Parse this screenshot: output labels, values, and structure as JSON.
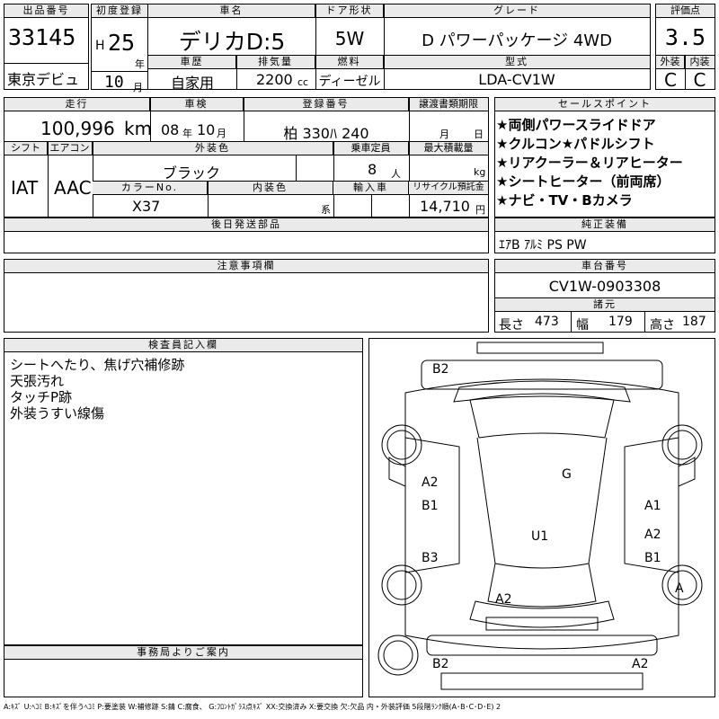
{
  "lot": {
    "header": "出品番号",
    "value": "33145",
    "venue": "東京デビュ"
  },
  "first_reg": {
    "header": "初度登録",
    "era": "H",
    "year": "25",
    "year_unit": "年",
    "month": "10",
    "month_unit": "月"
  },
  "car_name": {
    "header": "車名",
    "value": "デリカD:5"
  },
  "door": {
    "header": "ドア形状",
    "value": "5W"
  },
  "grade": {
    "header": "グレード",
    "value": "D パワーパッケージ 4WD"
  },
  "score": {
    "header": "評価点",
    "value": "3.5"
  },
  "history": {
    "header": "車歴",
    "value": "自家用"
  },
  "displacement": {
    "header": "排気量",
    "value": "2200",
    "unit": "cc"
  },
  "fuel": {
    "header": "燃料",
    "value": "ディーゼル"
  },
  "model": {
    "header": "型式",
    "value": "LDA-CV1W"
  },
  "exterior_score": {
    "header": "外装",
    "value": "C"
  },
  "interior_score": {
    "header": "内装",
    "value": "C"
  },
  "mileage": {
    "header": "走行",
    "value": "100,996",
    "unit": "km"
  },
  "inspection": {
    "header": "車検",
    "year": "08",
    "year_unit": "年",
    "month": "10",
    "month_unit": "月"
  },
  "registration": {
    "header": "登録番号",
    "value": "柏 330ﾊ 240"
  },
  "transfer": {
    "header": "譲渡書類期限",
    "month_unit": "月",
    "day_unit": "日"
  },
  "shift": {
    "header": "シフト",
    "value": "IAT"
  },
  "aircon": {
    "header": "エアコン",
    "value": "AAC"
  },
  "exterior_color": {
    "header": "外装色",
    "value": "ブラック"
  },
  "capacity": {
    "header": "乗車定員",
    "value": "8",
    "unit": "人"
  },
  "max_load": {
    "header": "最大積載量",
    "unit": "kg"
  },
  "color_no": {
    "header": "カラーNo.",
    "value": "X37"
  },
  "interior_color": {
    "header": "内装色",
    "unit": "系"
  },
  "import": {
    "header": "輸入車"
  },
  "recycle": {
    "header": "リサイクル預託金",
    "value": "14,710",
    "unit": "円"
  },
  "later_parts": {
    "header": "後日発送部品"
  },
  "sales_points": {
    "header": "セールスポイント",
    "items": [
      "★両側パワースライドドア",
      "★クルコン★パドルシフト",
      "★リアクーラー＆リアヒーター",
      "★シートヒーター（前両席）",
      "★ナビ・TV・Bカメラ"
    ]
  },
  "equipment": {
    "header": "純正装備",
    "value": "ｴｱB ｱﾙﾐ PS PW"
  },
  "notes": {
    "header": "注意事項欄"
  },
  "chassis": {
    "header": "車台番号",
    "value": "CV1W-0903308"
  },
  "dimensions": {
    "header": "諸元",
    "length_label": "長さ",
    "length": "473",
    "width_label": "幅",
    "width": "179",
    "height_label": "高さ",
    "height": "187"
  },
  "inspector": {
    "header": "検査員記入欄",
    "lines": [
      "シートへたり、焦げ穴補修跡",
      "天張汚れ",
      "タッチP跡",
      "外装うすい線傷"
    ]
  },
  "office": {
    "header": "事務局よりご案内"
  },
  "damage_marks": [
    "B2",
    "G",
    "A2",
    "B1",
    "A1",
    "A2",
    "B1",
    "U1",
    "B3",
    "A2",
    "A",
    "B2",
    "A2"
  ],
  "legend": "A:ｷｽﾞ U:ﾍｺﾐ B:ｷｽﾞを伴うﾍｺﾐ P:要塗装 W:補修跡 S:錆 C:腐食、 G:ﾌﾛﾝﾄｶﾞﾗｽ点ｷｽﾞ XX:交換済み X:要交換 欠:欠品 内・外装評価 5段階ﾗﾝｸ順(A･B･C･D･E) 2"
}
